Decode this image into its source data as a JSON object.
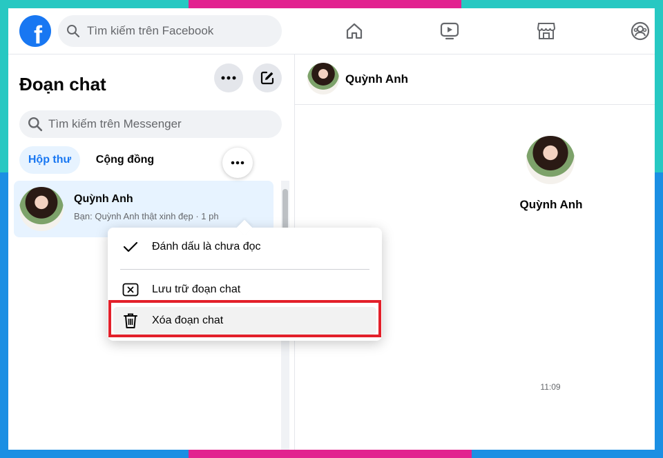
{
  "topbar": {
    "logo_letter": "f",
    "search_placeholder": "Tìm kiếm trên Facebook",
    "nav_icons": [
      "home-icon",
      "video-icon",
      "marketplace-icon",
      "groups-icon"
    ]
  },
  "sidebar": {
    "title": "Đoạn chat",
    "search_placeholder": "Tìm kiếm trên Messenger",
    "tabs": [
      {
        "label": "Hộp thư",
        "active": true
      },
      {
        "label": "Cộng đồng",
        "active": false
      }
    ],
    "conversation": {
      "name": "Quỳnh Anh",
      "preview": "Bạn: Quỳnh Anh thật xinh đẹp · 1 ph"
    }
  },
  "context_menu": {
    "items": [
      {
        "label": "Đánh dấu là chưa đọc",
        "icon": "check-icon"
      },
      {
        "label": "Lưu trữ đoạn chat",
        "icon": "archive-icon"
      },
      {
        "label": "Xóa đoạn chat",
        "icon": "trash-icon"
      }
    ]
  },
  "chat": {
    "header_name": "Quỳnh Anh",
    "profile_name": "Quỳnh Anh",
    "timestamp": "11:09"
  },
  "colors": {
    "facebook_blue": "#1877f2",
    "highlight_red": "#e3202a",
    "frame_teal": "#27c8c2",
    "frame_pink": "#e2228f",
    "frame_blue": "#1b8fe3"
  }
}
